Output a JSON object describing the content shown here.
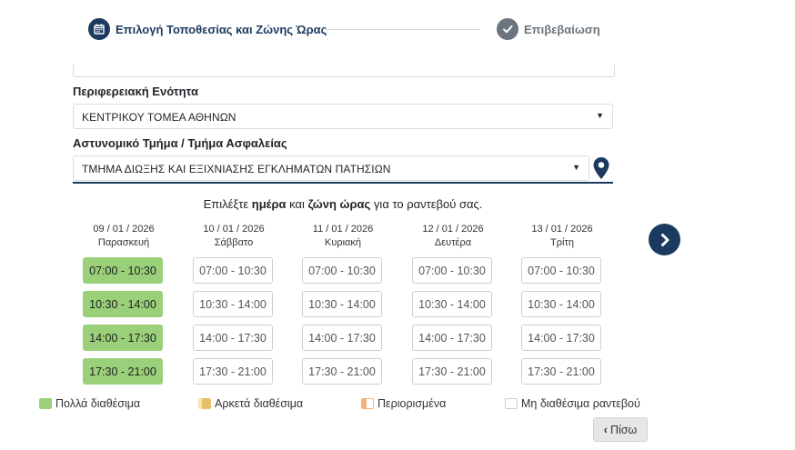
{
  "stepper": {
    "step1_label": "Επιλογή Τοποθεσίας και Ζώνης Ώρας",
    "step2_label": "Επιβεβαίωση"
  },
  "form": {
    "region_label": "Περιφερειακή Ενότητα",
    "region_value": "ΚΕΝΤΡΙΚΟΥ ΤΟΜΕΑ ΑΘΗΝΩΝ",
    "department_label": "Αστυνομικό Τμήμα / Τμήμα Ασφαλείας",
    "department_value": "ΤΜΗΜΑ ΔΙΩΞΗΣ ΚΑΙ ΕΞΙΧΝΙΑΣΗΣ ΕΓΚΛΗΜΑΤΩΝ ΠΑΤΗΣΙΩΝ"
  },
  "instruction": {
    "part1": "Επιλέξτε ",
    "bold1": "ημέρα",
    "part2": " και ",
    "bold2": "ζώνη ώρας",
    "part3": " για το ραντεβού σας."
  },
  "days": [
    {
      "date": "09 / 01 / 2026",
      "name": "Παρασκευή",
      "slots": [
        "07:00 - 10:30",
        "10:30 - 14:00",
        "14:00 - 17:30",
        "17:30 - 21:00"
      ],
      "available": [
        true,
        true,
        true,
        true
      ]
    },
    {
      "date": "10 / 01 / 2026",
      "name": "Σάββατο",
      "slots": [
        "07:00 - 10:30",
        "10:30 - 14:00",
        "14:00 - 17:30",
        "17:30 - 21:00"
      ],
      "available": [
        false,
        false,
        false,
        false
      ]
    },
    {
      "date": "11 / 01 / 2026",
      "name": "Κυριακή",
      "slots": [
        "07:00 - 10:30",
        "10:30 - 14:00",
        "14:00 - 17:30",
        "17:30 - 21:00"
      ],
      "available": [
        false,
        false,
        false,
        false
      ]
    },
    {
      "date": "12 / 01 / 2026",
      "name": "Δευτέρα",
      "slots": [
        "07:00 - 10:30",
        "10:30 - 14:00",
        "14:00 - 17:30",
        "17:30 - 21:00"
      ],
      "available": [
        false,
        false,
        false,
        false
      ]
    },
    {
      "date": "13 / 01 / 2026",
      "name": "Τρίτη",
      "slots": [
        "07:00 - 10:30",
        "10:30 - 14:00",
        "14:00 - 17:30",
        "17:30 - 21:00"
      ],
      "available": [
        false,
        false,
        false,
        false
      ]
    }
  ],
  "legend": {
    "many": "Πολλά διαθέσιμα",
    "enough": "Αρκετά διαθέσιμα",
    "limited": "Περιορισμένα",
    "none": "Μη διαθέσιμα ραντεβού"
  },
  "colors": {
    "primary": "#1c3a5e",
    "available": "#9ad07a",
    "enough": "#e8c06a",
    "limited": "#f0b47a",
    "none_border": "#cfcfcf"
  },
  "buttons": {
    "back_label": "Πίσω"
  }
}
